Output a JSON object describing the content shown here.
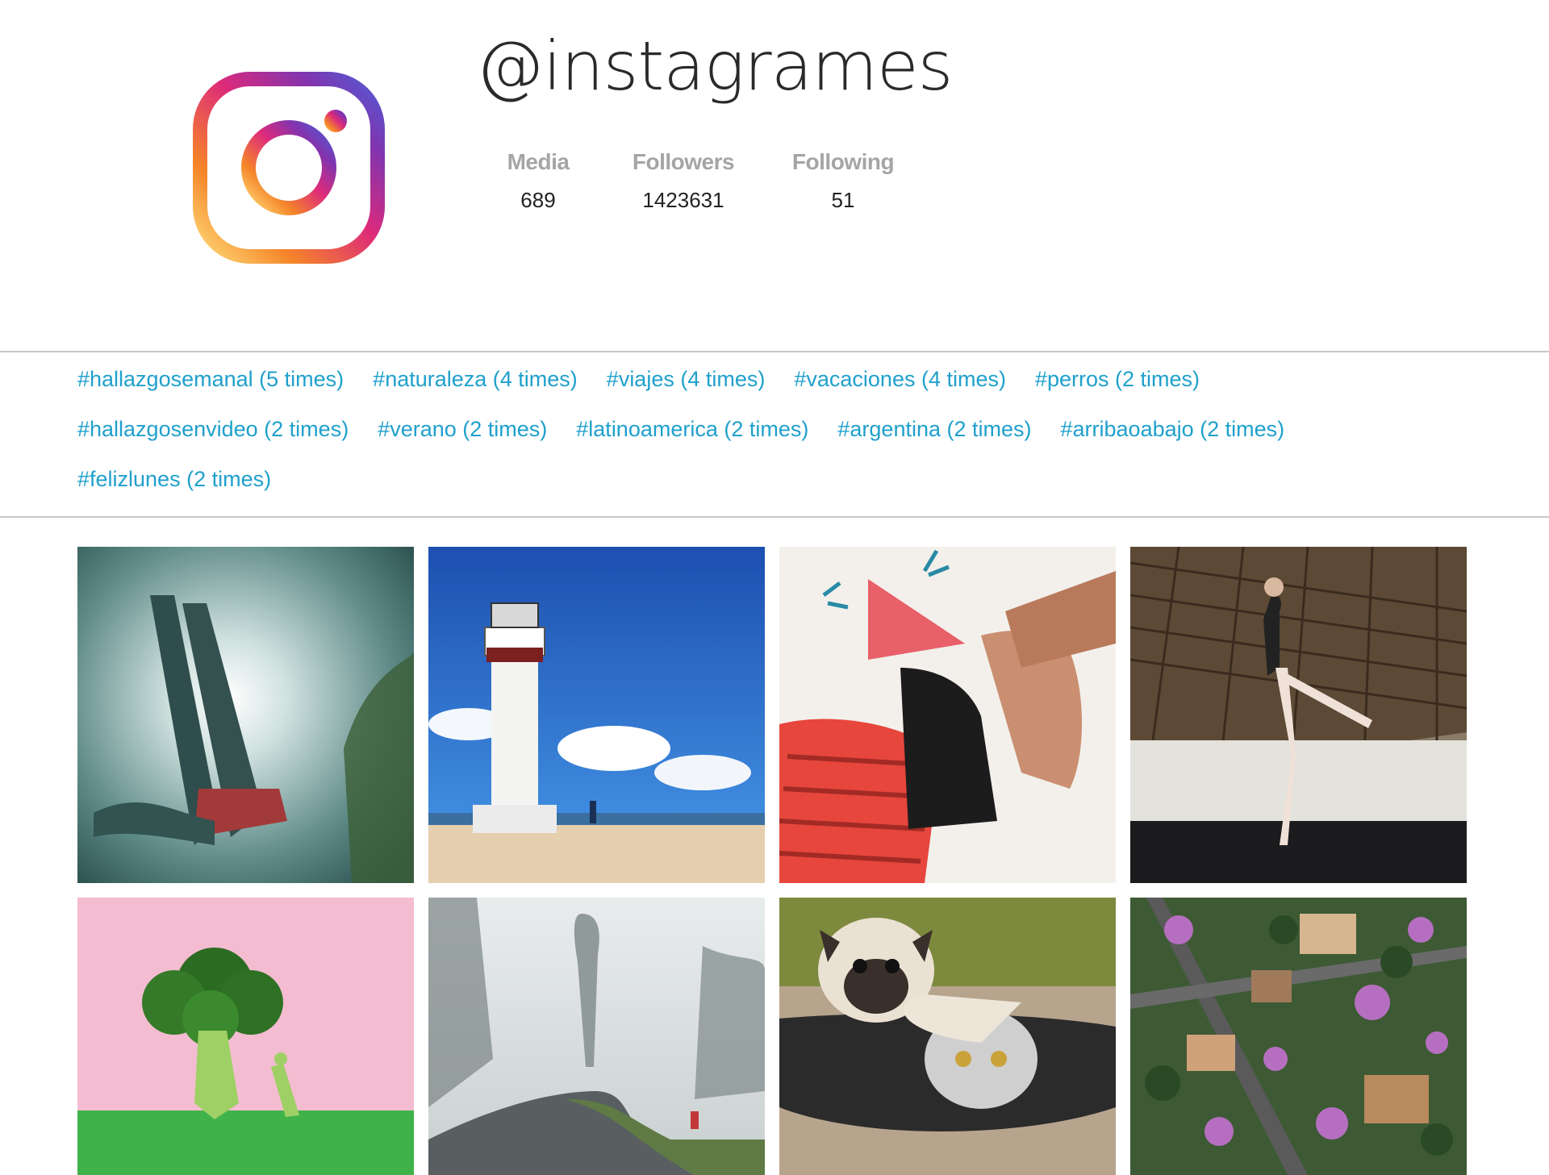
{
  "profile": {
    "username": "@instagrames",
    "logo_icon": "instagram-logo-icon",
    "stats": [
      {
        "label": "Media",
        "value": "689"
      },
      {
        "label": "Followers",
        "value": "1423631"
      },
      {
        "label": "Following",
        "value": "51"
      }
    ]
  },
  "hashtags": [
    "#hallazgosemanal (5 times)",
    "#naturaleza (4 times)",
    "#viajes (4 times)",
    "#vacaciones (4 times)",
    "#perros (2 times)",
    "#hallazgosenvideo (2 times)",
    "#verano (2 times)",
    "#latinoamerica (2 times)",
    "#argentina (2 times)",
    "#arribaoabajo (2 times)",
    "#felizlunes (2 times)"
  ],
  "photos": [
    {
      "subject": "underwater-swimmer-photo"
    },
    {
      "subject": "lighthouse-beach-photo"
    },
    {
      "subject": "illustration-drawing-photo"
    },
    {
      "subject": "ballet-dancer-photo"
    },
    {
      "subject": "broccoli-figure-photo"
    },
    {
      "subject": "foggy-road-cyclist-photo"
    },
    {
      "subject": "pug-and-cat-photo"
    },
    {
      "subject": "aerial-city-trees-photo"
    }
  ],
  "colors": {
    "link": "#1fa0cc",
    "stat_label": "#a5a5a5",
    "divider": "#c8c8c8",
    "logo_gradient": [
      "#515bd4",
      "#8134af",
      "#dd2a7b",
      "#f58529",
      "#feda77"
    ]
  }
}
